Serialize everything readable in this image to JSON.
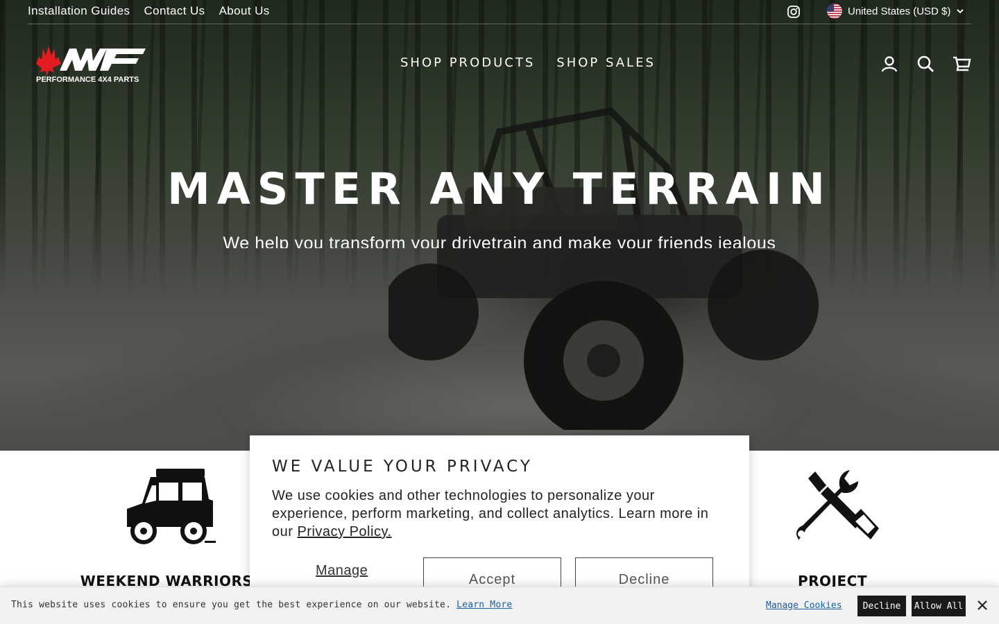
{
  "utility_bar": {
    "links": [
      "Installation Guides",
      "Contact Us",
      "About Us"
    ],
    "social_icon": "instagram-icon",
    "country_label": "United States (USD $)",
    "country_icon": "us-flag-icon"
  },
  "header": {
    "logo_text": "NWF",
    "logo_tagline": "PERFORMANCE 4X4 PARTS",
    "nav": [
      "SHOP PRODUCTS",
      "SHOP SALES"
    ],
    "icons": [
      "account-icon",
      "search-icon",
      "cart-icon"
    ]
  },
  "hero": {
    "title": "MASTER ANY TERRAIN",
    "subtitle": "We help you transform your drivetrain and make your friends jealous"
  },
  "features": [
    {
      "title": "WEEKEND WARRIORS",
      "icon": "offroad-truck-icon"
    },
    {
      "title": "PROJECT ENTHUSIASTS",
      "icon": "wrench-screwdriver-icon"
    }
  ],
  "privacy_modal": {
    "heading": "WE VALUE YOUR PRIVACY",
    "body": "We use cookies and other technologies to personalize your experience, perform marketing, and collect analytics. Learn more in our ",
    "policy_link": "Privacy Policy.",
    "manage_label": "Manage preferences",
    "accept_label": "Accept",
    "decline_label": "Decline"
  },
  "cookie_bar": {
    "message": "This website uses cookies to ensure you get the best experience on our website.",
    "learn_more": "Learn More",
    "manage": "Manage Cookies",
    "decline": "Decline",
    "allow": "Allow All",
    "close_icon": "close-icon"
  },
  "colors": {
    "brand_red": "#e31b23",
    "link_blue": "#1a5fa8",
    "dark_button": "#1a1a1a"
  }
}
